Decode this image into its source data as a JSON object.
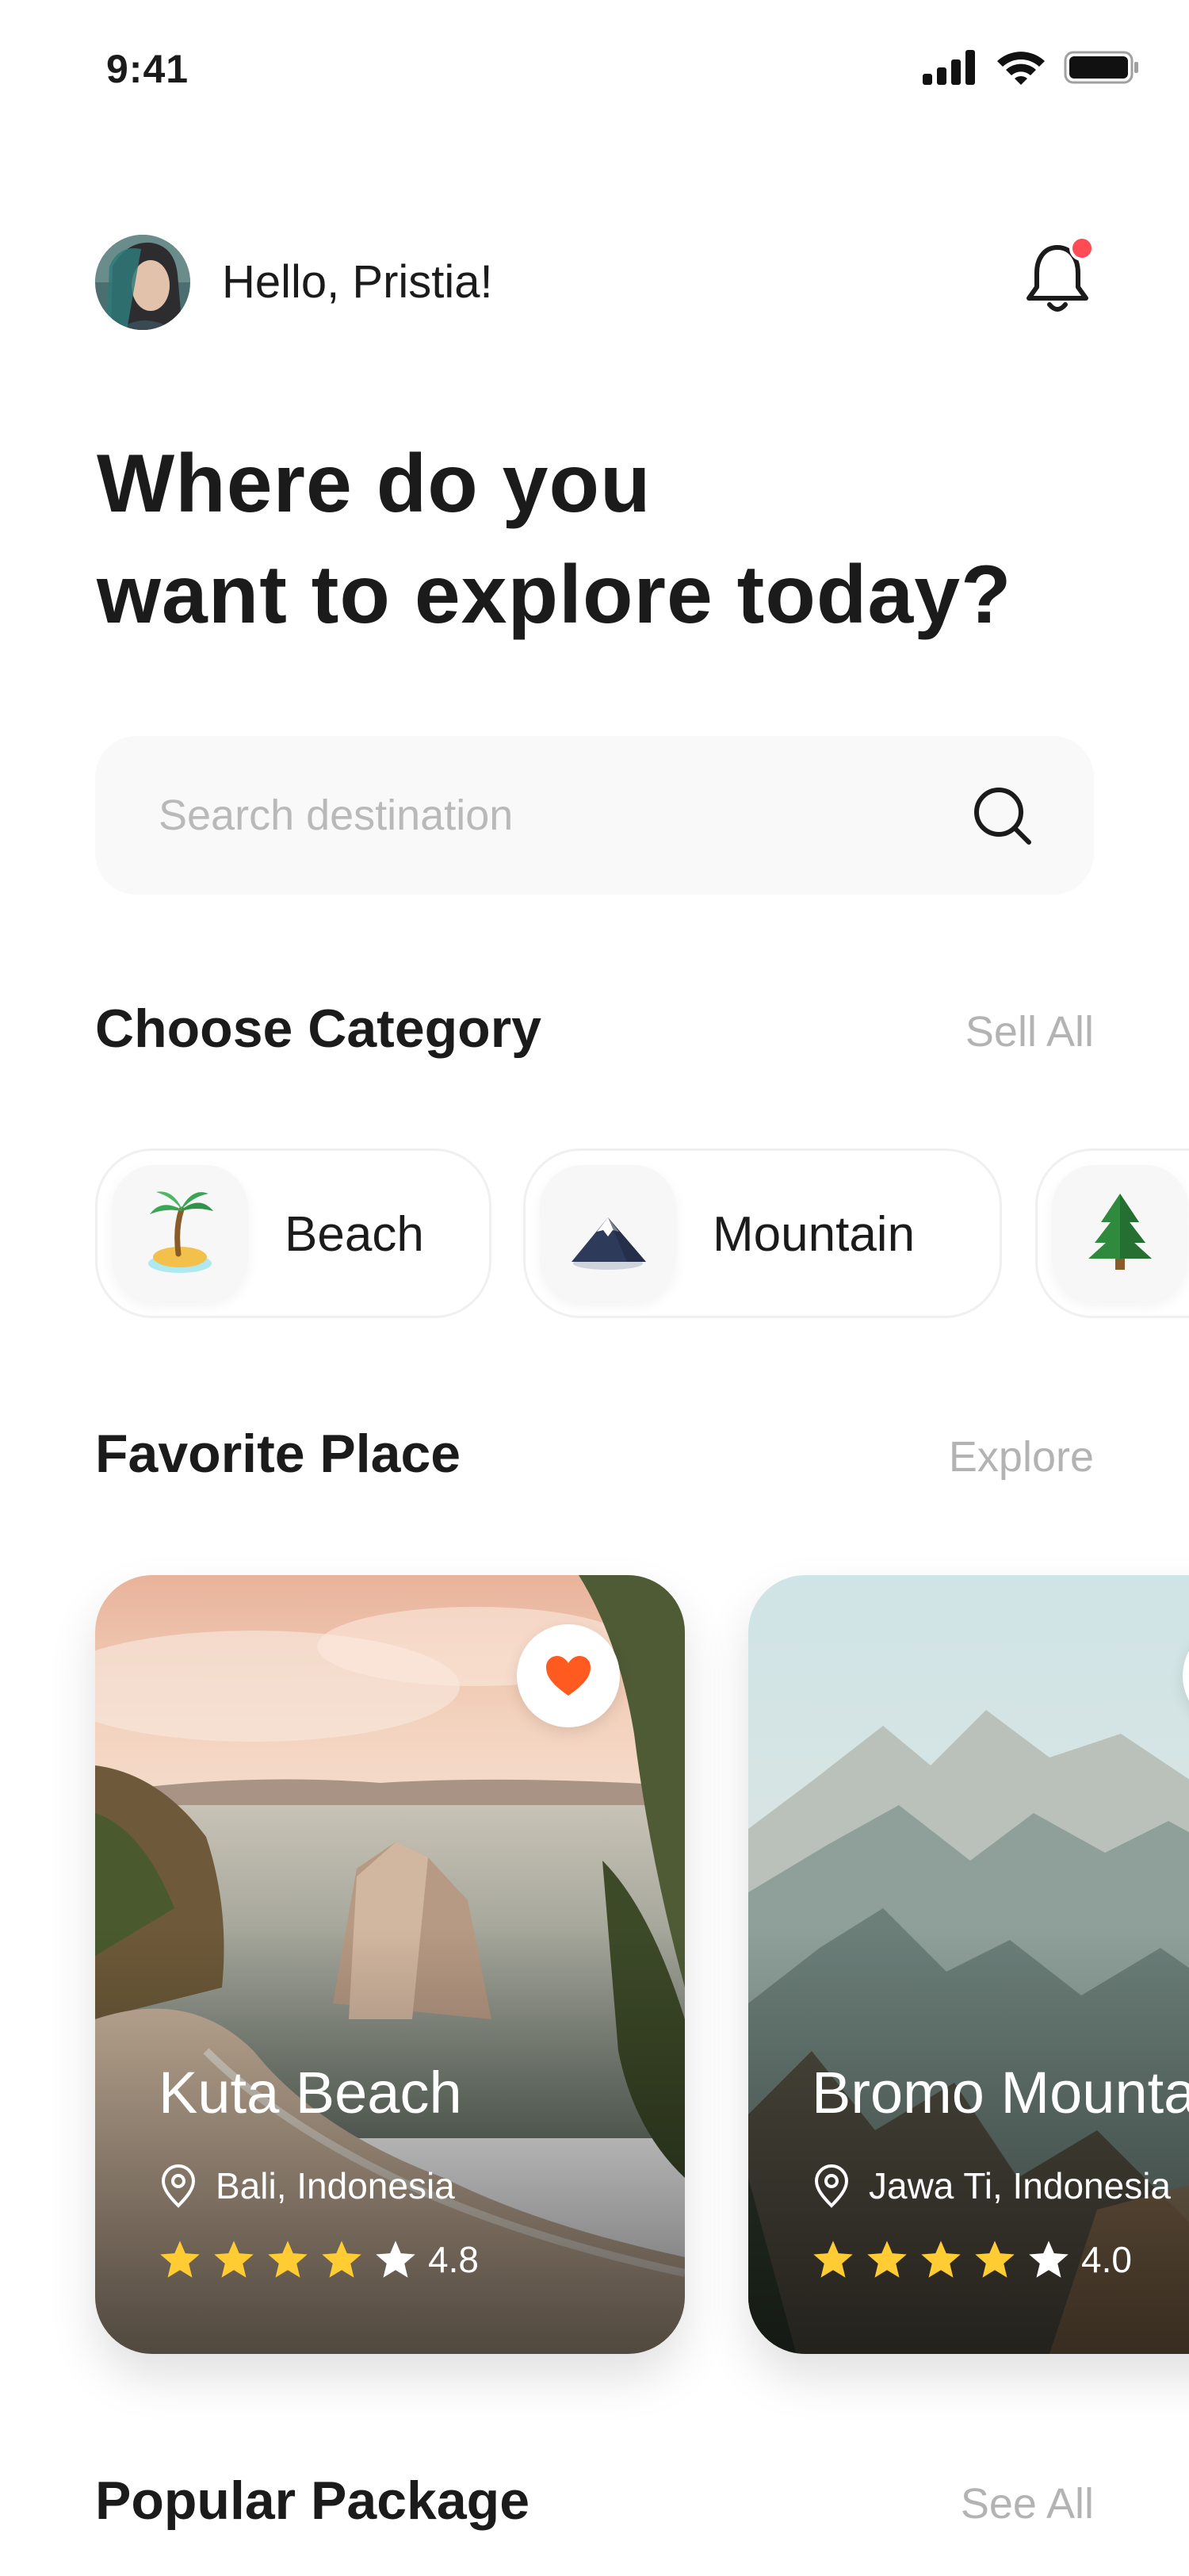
{
  "status_bar": {
    "time": "9:41"
  },
  "header": {
    "greeting": "Hello, Pristia!",
    "headline_line1": "Where do you",
    "headline_line2": "want to explore today?"
  },
  "search": {
    "placeholder": "Search destination"
  },
  "categories_section": {
    "title": "Choose Category",
    "link": "Sell All",
    "items": [
      {
        "label": "Beach",
        "icon": "palm-island-icon"
      },
      {
        "label": "Mountain",
        "icon": "mountain-icon"
      },
      {
        "label": "",
        "icon": "pine-tree-icon"
      }
    ]
  },
  "favorite_section": {
    "title": "Favorite Place",
    "link": "Explore",
    "places": [
      {
        "name": "Kuta Beach",
        "location": "Bali, Indonesia",
        "rating": "4.8",
        "filled_stars": 4,
        "favorited": true
      },
      {
        "name": "Bromo Mountain",
        "location": "Jawa Ti, Indonesia",
        "rating": "4.0",
        "filled_stars": 4,
        "favorited": false
      }
    ]
  },
  "popular_section": {
    "title": "Popular Package",
    "link": "See All"
  },
  "colors": {
    "accent": "#ff5a1f",
    "star": "#ffcc33",
    "notification_dot": "#ff4b55",
    "muted_text": "#b3b3b3"
  }
}
